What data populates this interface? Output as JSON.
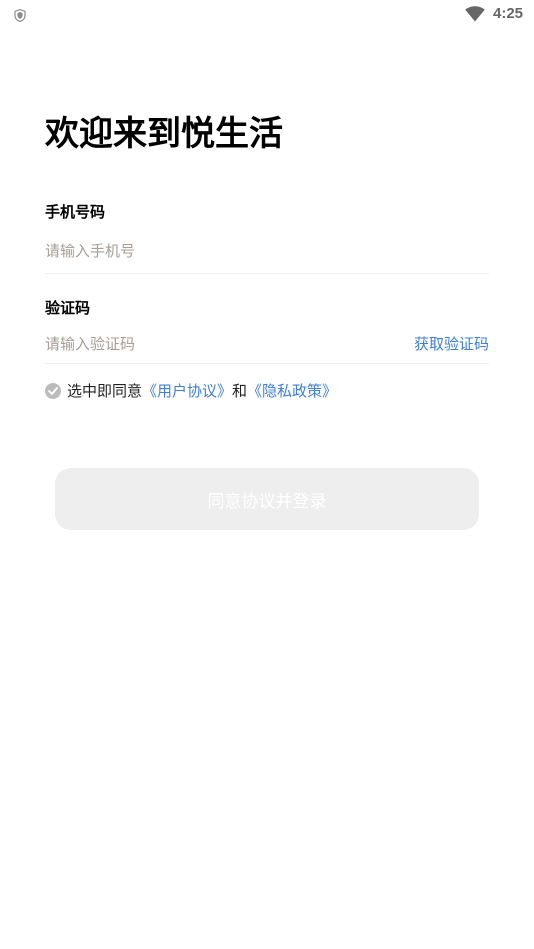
{
  "status_bar": {
    "time": "4:25",
    "icons": [
      "shield-icon",
      "wifi-icon"
    ]
  },
  "welcome": {
    "title": "欢迎来到悦生活"
  },
  "phone": {
    "label": "手机号码",
    "placeholder": "请输入手机号",
    "value": ""
  },
  "code": {
    "label": "验证码",
    "placeholder": "请输入验证码",
    "value": "",
    "get_code_label": "获取验证码"
  },
  "agreement": {
    "prefix": "选中即同意",
    "user_agreement": "《用户协议》",
    "conjunction": "和",
    "privacy_policy": "《隐私政策》",
    "checked": false
  },
  "login_button": {
    "label": "同意协议并登录"
  },
  "colors": {
    "link": "#3f7fd6",
    "placeholder": "#a89c95",
    "button_disabled": "#eeeeee"
  }
}
